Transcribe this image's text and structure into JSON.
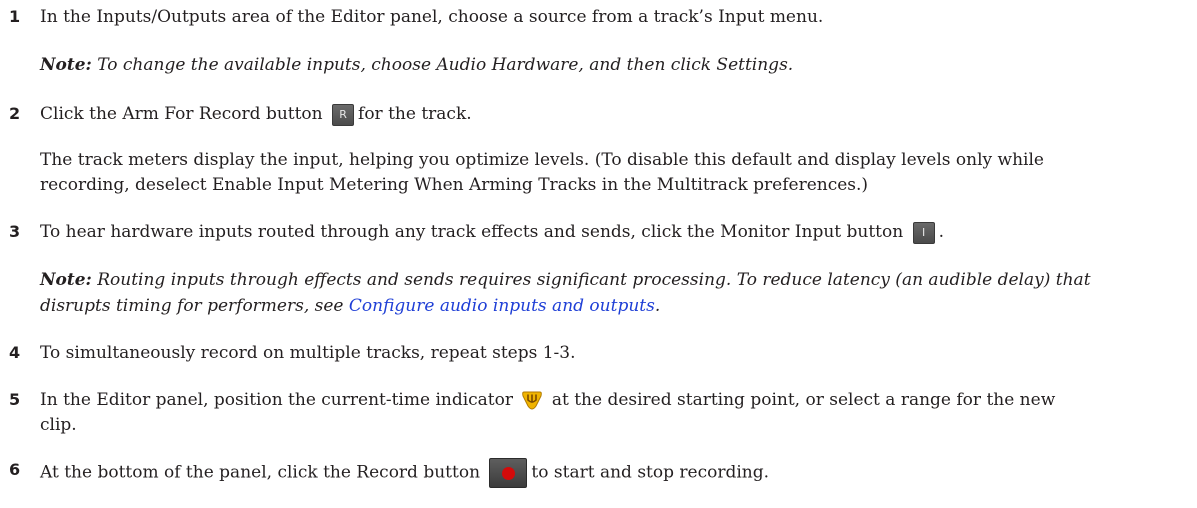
{
  "steps": [
    {
      "num": "1",
      "text": "In the Inputs/Outputs area of the Editor panel, choose a source from a track’s Input menu."
    },
    {
      "note_label": "Note:",
      "note_text": " To change the available inputs, choose Audio Hardware, and then click Settings."
    },
    {
      "num": "2",
      "text_before": "Click the Arm For Record button ",
      "icon_label": "R",
      "text_after": "for the track."
    },
    {
      "line1": "The track meters display the input, helping you optimize levels. (To disable this default and display levels only while",
      "line2": "recording, deselect Enable Input Metering When Arming Tracks in the Multitrack preferences.)"
    },
    {
      "num": "3",
      "text_before": "To hear hardware inputs routed through any track effects and sends, click the Monitor Input button ",
      "icon_label": "I",
      "text_after": "."
    },
    {
      "note_label": "Note:",
      "note_line1": " Routing inputs through effects and sends requires significant processing. To reduce latency (an audible delay) that",
      "note_line2_before": "disrupts timing for performers, see ",
      "link": "Configure audio inputs and outputs",
      "note_line2_after": "."
    },
    {
      "num": "4",
      "text": "To simultaneously record on multiple tracks, repeat steps 1-3."
    },
    {
      "num": "5",
      "text_before": "In the Editor panel, position the current-time indicator ",
      "text_after": " at the desired starting point, or select a range for the new",
      "line2": "clip."
    },
    {
      "num": "6",
      "text_before": "At the bottom of the panel, click the Record button ",
      "text_after": "to start and stop recording."
    }
  ],
  "icons": {
    "arm_record": "arm-record-icon",
    "monitor_input": "monitor-input-icon",
    "cti": "current-time-indicator-icon",
    "record": "record-icon"
  },
  "colors": {
    "text": "#231f20",
    "link": "#1f3fd6",
    "record_dot": "#d40a0a",
    "cti": "#f0b400"
  }
}
